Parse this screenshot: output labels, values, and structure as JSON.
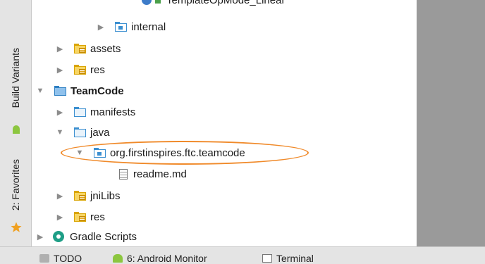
{
  "side_tabs": {
    "build_variants": "Build Variants",
    "favorites": "2: Favorites"
  },
  "tree": {
    "top_item": "TemplateOpMode_Linear",
    "internal": "internal",
    "assets": "assets",
    "res_1": "res",
    "teamcode": "TeamCode",
    "manifests": "manifests",
    "java": "java",
    "package": "org.firstinspires.ftc.teamcode",
    "readme": "readme.md",
    "jnilibs": "jniLibs",
    "res_2": "res",
    "gradle_scripts": "Gradle Scripts"
  },
  "bottom_tabs": {
    "todo": "TODO",
    "android_monitor": "6: Android Monitor",
    "terminal": "Terminal"
  },
  "colors": {
    "highlight": "#f08a2a",
    "folder_blue": "#3b8fd0",
    "folder_yellow": "#f7d563"
  }
}
